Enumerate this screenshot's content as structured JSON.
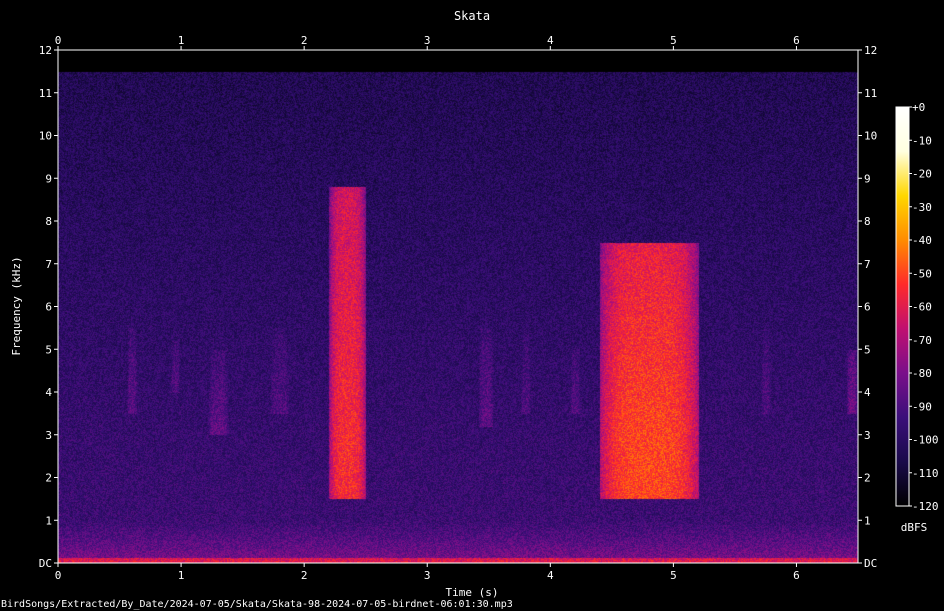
{
  "chart_data": {
    "type": "heatmap",
    "title": "Skata",
    "xlabel": "Time (s)",
    "ylabel": "Frequency (kHz)",
    "xlim": [
      0,
      6.5
    ],
    "ylim": [
      0,
      12
    ],
    "x_ticks": [
      "0",
      "1",
      "2",
      "3",
      "4",
      "5",
      "6"
    ],
    "y_ticks": [
      "DC",
      "1",
      "2",
      "3",
      "4",
      "5",
      "6",
      "7",
      "8",
      "9",
      "10",
      "11",
      "12"
    ],
    "colorbar": {
      "label": "dBFS",
      "ticks": [
        "+0",
        "-10",
        "-20",
        "-30",
        "-40",
        "-50",
        "-60",
        "-70",
        "-80",
        "-90",
        "-100",
        "-110",
        "-120"
      ],
      "range": [
        -120,
        0
      ],
      "colormap": [
        "#000000",
        "#1a0a4a",
        "#3b0f7a",
        "#7a0f8a",
        "#c01070",
        "#ff2a2a",
        "#ff8c00",
        "#ffd700",
        "#ffffe0",
        "#ffffff"
      ]
    },
    "frequency_cutoff_khz": 11.5,
    "events": [
      {
        "t_start": 2.2,
        "t_end": 2.5,
        "f_low": 1.5,
        "f_high": 8.8,
        "peak_db": -55
      },
      {
        "t_start": 4.4,
        "t_end": 5.2,
        "f_low": 1.5,
        "f_high": 7.5,
        "peak_db": -50
      },
      {
        "t_start": 0.55,
        "t_end": 0.65,
        "f_low": 3.5,
        "f_high": 5.5,
        "peak_db": -85
      },
      {
        "t_start": 0.9,
        "t_end": 1.0,
        "f_low": 4.0,
        "f_high": 5.2,
        "peak_db": -85
      },
      {
        "t_start": 1.2,
        "t_end": 1.4,
        "f_low": 3.0,
        "f_high": 5.0,
        "peak_db": -85
      },
      {
        "t_start": 1.7,
        "t_end": 1.9,
        "f_low": 3.5,
        "f_high": 5.5,
        "peak_db": -87
      },
      {
        "t_start": 3.4,
        "t_end": 3.55,
        "f_low": 3.2,
        "f_high": 5.5,
        "peak_db": -85
      },
      {
        "t_start": 3.75,
        "t_end": 3.85,
        "f_low": 3.5,
        "f_high": 5.5,
        "peak_db": -87
      },
      {
        "t_start": 4.15,
        "t_end": 4.25,
        "f_low": 3.5,
        "f_high": 5.0,
        "peak_db": -85
      },
      {
        "t_start": 5.7,
        "t_end": 5.8,
        "f_low": 3.5,
        "f_high": 5.5,
        "peak_db": -87
      },
      {
        "t_start": 6.4,
        "t_end": 6.5,
        "f_low": 3.5,
        "f_high": 5.0,
        "peak_db": -80
      }
    ]
  },
  "file_path": "BirdSongs/Extracted/By_Date/2024-07-05/Skata/Skata-98-2024-07-05-birdnet-06:01:30.mp3"
}
